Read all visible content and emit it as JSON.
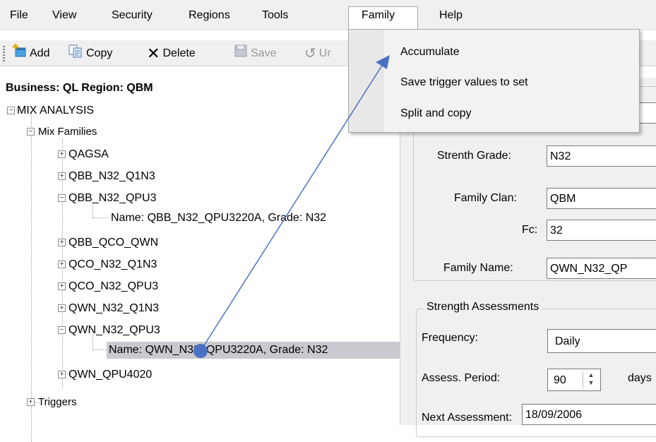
{
  "menubar": {
    "items": [
      "File",
      "View",
      "Security",
      "Regions",
      "Tools",
      "Family",
      "Help"
    ]
  },
  "toolbar": {
    "add_label": "Add",
    "copy_label": "Copy",
    "delete_label": "Delete",
    "save_label": "Save",
    "undo_label": "Ur"
  },
  "tree": {
    "header": "Business: QL  Region: QBM",
    "root": "MIX ANALYSIS",
    "mix_families": "Mix Families",
    "families": [
      "QAGSA",
      "QBB_N32_Q1N3",
      "QBB_N32_QPU3",
      "Name: QBB_N32_QPU3220A, Grade: N32",
      "QBB_QCO_QWN",
      "QCO_N32_Q1N3",
      "QCO_N32_QPU3",
      "QWN_N32_Q1N3",
      "QWN_N32_QPU3",
      "Name: QWN_N32_QPU3220A, Grade: N32",
      "QWN_QPU4020"
    ],
    "triggers": "Triggers"
  },
  "family_menu": {
    "items": [
      "Accumulate",
      "Save trigger values to set",
      "Split and copy"
    ]
  },
  "details": {
    "partial_value": "QP",
    "strength_grade_label": "Strenth Grade:",
    "strength_grade_value": "N32",
    "family_clan_label": "Family Clan:",
    "family_clan_value": "QBM",
    "fc_label": "Fc:",
    "fc_value": "32",
    "family_name_label": "Family Name:",
    "family_name_value": "QWN_N32_QP"
  },
  "assessments": {
    "title": "Strength Assessments",
    "frequency_label": "Frequency:",
    "frequency_value": "Daily",
    "period_label": "Assess. Period:",
    "period_value": "90",
    "period_unit": "days",
    "next_label": "Next Assessment:",
    "next_value": "18/09/2006"
  },
  "colors": {
    "arrow": "#4a72c4",
    "selection": "#c9c9cf"
  }
}
